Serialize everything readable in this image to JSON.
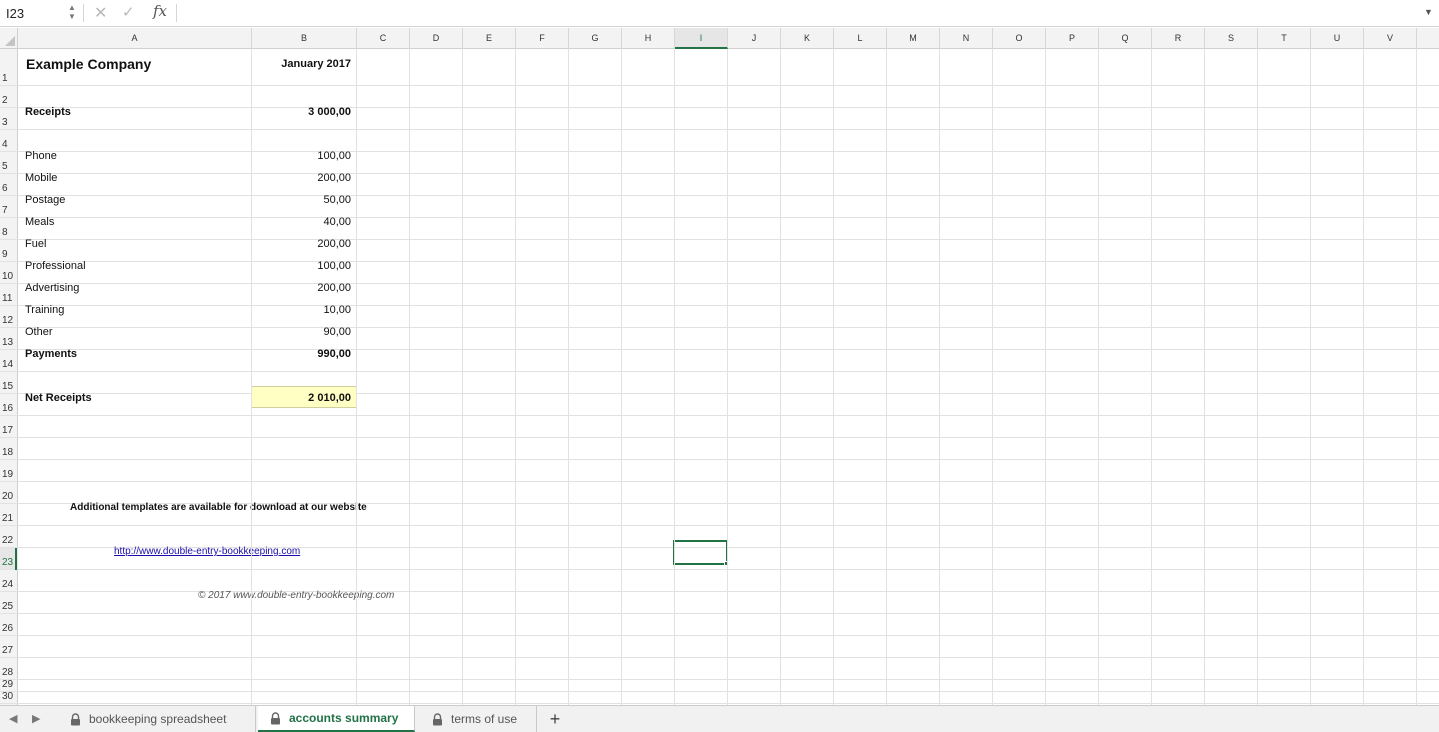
{
  "formula_bar": {
    "name_box": "I23",
    "formula": "",
    "fx_label": "fx"
  },
  "columns": [
    "A",
    "B",
    "C",
    "D",
    "E",
    "F",
    "G",
    "H",
    "I",
    "J",
    "K",
    "L",
    "M",
    "N",
    "O",
    "P",
    "Q",
    "R",
    "S",
    "T",
    "U",
    "V"
  ],
  "active_column": "I",
  "rows": [
    "1",
    "2",
    "3",
    "4",
    "5",
    "6",
    "7",
    "8",
    "9",
    "10",
    "11",
    "12",
    "13",
    "14",
    "15",
    "16",
    "17",
    "18",
    "19",
    "20",
    "21",
    "22",
    "23",
    "24",
    "25",
    "26",
    "27",
    "28",
    "29",
    "30"
  ],
  "active_row": "23",
  "sheet": {
    "company": "Example Company",
    "period": "January 2017",
    "receipts_label": "Receipts",
    "receipts_value": "3 000,00",
    "expenses": [
      {
        "label": "Phone",
        "value": "100,00"
      },
      {
        "label": "Mobile",
        "value": "200,00"
      },
      {
        "label": "Postage",
        "value": "50,00"
      },
      {
        "label": "Meals",
        "value": "40,00"
      },
      {
        "label": "Fuel",
        "value": "200,00"
      },
      {
        "label": "Professional",
        "value": "100,00"
      },
      {
        "label": "Advertising",
        "value": "200,00"
      },
      {
        "label": "Training",
        "value": "10,00"
      },
      {
        "label": "Other",
        "value": "90,00"
      }
    ],
    "payments_label": "Payments",
    "payments_value": "990,00",
    "net_label": "Net Receipts",
    "net_value": "2 010,00",
    "templates_note": "Additional templates are available for download at our website",
    "website_link": "http://www.double-entry-bookkeeping.com",
    "copyright": "© 2017 www.double-entry-bookkeeping.com"
  },
  "tabs": [
    {
      "label": "bookkeeping spreadsheet",
      "locked": true,
      "active": false
    },
    {
      "label": "accounts summary",
      "locked": true,
      "active": true
    },
    {
      "label": "terms of use",
      "locked": true,
      "active": false
    }
  ],
  "add_sheet_label": "+",
  "colors": {
    "accent": "#217346",
    "highlight": "#ffffc4",
    "link": "#1a0dab"
  }
}
